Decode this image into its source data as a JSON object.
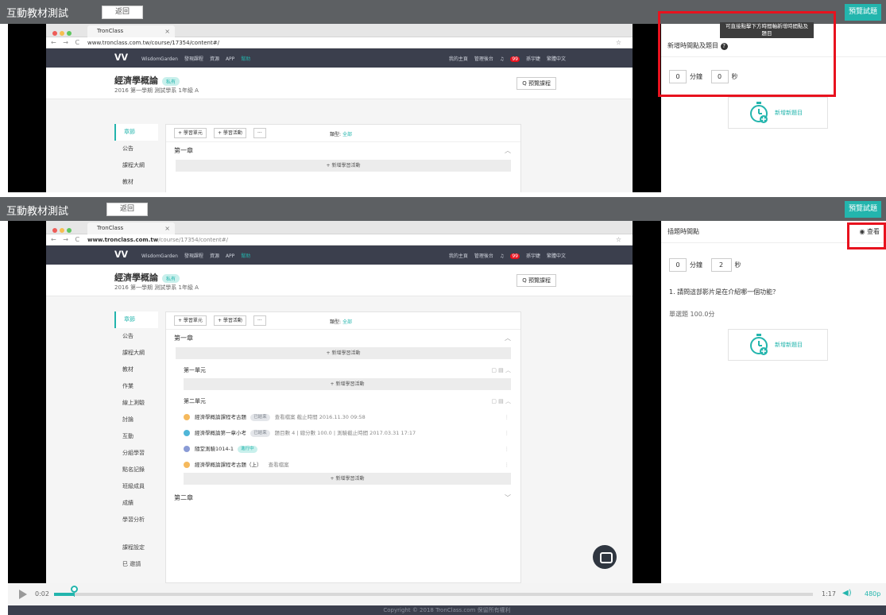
{
  "colors": {
    "accent": "#23b5ad",
    "highlight": "#e8121e",
    "topbar": "#5d6063",
    "sitenav": "#3b3f4d"
  },
  "app": {
    "title": "互動教材測試",
    "back_label": "返回",
    "preview_label": "預覽試題"
  },
  "browser": {
    "tab_title": "TronClass",
    "url_top": "www.tronclass.com.tw/course/17354/content#/",
    "url_host": "www.tronclass.com.tw",
    "url_path": "/course/17354/content#/"
  },
  "site": {
    "logo_text": "WisdomGarden",
    "nav_left": [
      "發現課程",
      "資源",
      "APP",
      "幫助"
    ],
    "nav_right": [
      "我的主頁",
      "管理後台",
      "孫宇婕",
      "繁體中文"
    ],
    "notif_count": "99"
  },
  "course": {
    "title": "經濟學概論",
    "badge": "私有",
    "subtitle": "2016 第一學期 測試學系 1年級 A",
    "search_label": "Q 預覽課程"
  },
  "sidebar_items": [
    "章節",
    "公告",
    "課程大綱",
    "教材",
    "作業",
    "線上測驗",
    "討論",
    "互動",
    "分組學習",
    "點名記錄",
    "班級成員",
    "成績",
    "學習分析"
  ],
  "sidebar_bottom": [
    "課程設定",
    "巳 邀請"
  ],
  "content": {
    "toolbar": [
      "+ 學習單元",
      "+ 學習活動",
      "···"
    ],
    "filter_label": "類型:",
    "filter_value": "全部",
    "chapter1": "第一章",
    "add_activity": "+ 新增學習活動",
    "unit1": "第一單元",
    "unit2": "第二單元",
    "chapter2": "第二章",
    "activities": [
      {
        "title": "經濟學概論課程考古題",
        "tag": "已結束",
        "extra": "查看檔案  截止時間  2016.11.30 09:58",
        "icon_color": "#f5b95d",
        "tag_color": "#9aa0aa"
      },
      {
        "title": "經濟學概論第一章小考",
        "tag": "已結束",
        "extra": "題目數  4  |  總分數  100.0  |  測驗截止時間  2017.03.31 17:17",
        "icon_color": "#4fb6d8",
        "tag_color": "#9aa0aa"
      },
      {
        "title": "隨堂測驗1014-1",
        "tag": "進行中",
        "extra": "",
        "icon_color": "#8a9bd6",
        "tag_color": "#23b5ad"
      },
      {
        "title": "經濟學概論課程考古題（上）",
        "tag": "",
        "extra": "查看檔案",
        "icon_color": "#f5b95d",
        "tag_color": "#9aa0aa"
      }
    ]
  },
  "top_right": {
    "tooltip": "可直接點擊下方時間軸新增時間點及題目",
    "header": "新增時間點及題目",
    "minutes_value": "0",
    "minutes_label": "分鐘",
    "seconds_value": "0",
    "seconds_label": "秒",
    "new_question_label": "新增新題目"
  },
  "bottom_right": {
    "header": "插題時間點",
    "view_label": "查看",
    "minutes_value": "0",
    "minutes_label": "分鐘",
    "seconds_value": "2",
    "seconds_label": "秒",
    "question": "1. 請問這部影片是在介紹哪一個功能？",
    "question_meta": "單選題 100.0分",
    "new_question_label": "新增新題目"
  },
  "player": {
    "current_time": "0:02",
    "total_time": "1:17",
    "quality": "480p",
    "progress_fraction": 0.026
  },
  "footer": {
    "copyright": "Copyright © 2018 TronClass.com 保留所有權利"
  }
}
